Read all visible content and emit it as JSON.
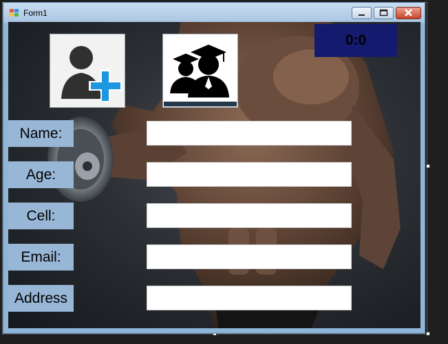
{
  "window": {
    "title": "Form1"
  },
  "score": {
    "text": "0:0"
  },
  "buttons": {
    "add_user_icon": "add-user-icon",
    "students_icon": "graduate-students-icon"
  },
  "form": {
    "fields": [
      {
        "label": "Name:",
        "value": ""
      },
      {
        "label": "Age:",
        "value": ""
      },
      {
        "label": "Cell:",
        "value": ""
      },
      {
        "label": "Email:",
        "value": ""
      },
      {
        "label": "Address",
        "value": ""
      }
    ]
  },
  "colors": {
    "label_bg": "#98b6d6",
    "score_bg": "#141a6e",
    "add_plus": "#1e96e0"
  }
}
